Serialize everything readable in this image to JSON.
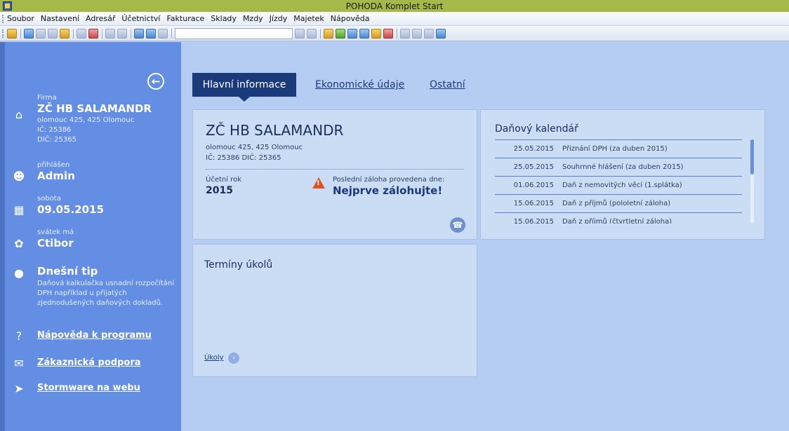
{
  "window": {
    "title": "POHODA Komplet Start"
  },
  "menu": [
    "Soubor",
    "Nastavení",
    "Adresář",
    "Účetnictví",
    "Fakturace",
    "Sklady",
    "Mzdy",
    "Jízdy",
    "Majetek",
    "Nápověda"
  ],
  "toolbar": {
    "combo_value": ""
  },
  "sidebar": {
    "collapse_icon": "arrow-left-circle-icon",
    "firma": {
      "label": "Firma",
      "name": "ZČ HB SALAMANDR",
      "address": "olomouc 425, 425 Olomouc",
      "ic": "IČ: 25386",
      "dic": "DIČ: 25365"
    },
    "user": {
      "label": "přihlášen",
      "name": "Admin"
    },
    "date": {
      "label": "sobota",
      "value": "09.05.2015"
    },
    "namesday": {
      "label": "svátek má",
      "name": "Ctibor"
    },
    "tip": {
      "title": "Dnešní tip",
      "text": "Daňová kalkulačka usnadní rozpočítání DPH například u přijatých zjednodušených daňových dokladů."
    },
    "links": {
      "help": "Nápověda k programu",
      "support": "Zákaznická podpora",
      "web": "Stormware na webu"
    }
  },
  "tabs": {
    "active": "Hlavní informace",
    "economic": "Ekonomické údaje",
    "other": "Ostatní"
  },
  "firma_panel": {
    "name": "ZČ HB SALAMANDR",
    "address": "olomouc 425, 425 Olomouc",
    "ids": "IČ: 25386  DIČ: 25365",
    "rok_label": "Účetní rok",
    "rok_value": "2015",
    "zaloha_label": "Poslední záloha provedena dne:",
    "zaloha_value": "Nejprve zálohujte!"
  },
  "calendar": {
    "title": "Daňový kalendář",
    "rows": [
      {
        "date": "25.05.2015",
        "text": "Přiznání DPH (za duben 2015)"
      },
      {
        "date": "25.05.2015",
        "text": "Souhrnné hlášení (za duben 2015)"
      },
      {
        "date": "01.06.2015",
        "text": "Daň z nemovitých věcí (1.splátka)"
      },
      {
        "date": "15.06.2015",
        "text": "Daň z příjmů (pololetní záloha)"
      },
      {
        "date": "15.06.2015",
        "text": "Daň z příjmů (čtvrtletní záloha)"
      }
    ]
  },
  "tasks": {
    "title": "Termíny úkolů",
    "link": "Úkoly"
  }
}
